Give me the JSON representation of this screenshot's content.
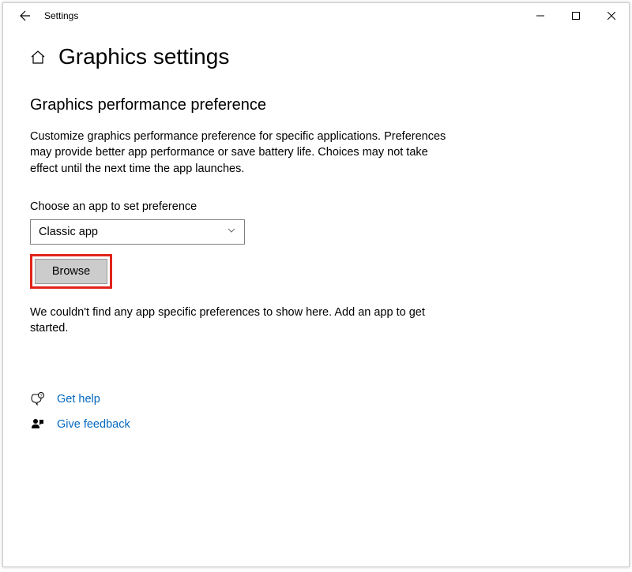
{
  "window": {
    "title": "Settings"
  },
  "page": {
    "title": "Graphics settings"
  },
  "section": {
    "heading": "Graphics performance preference",
    "description": "Customize graphics performance preference for specific applications. Preferences may provide better app performance or save battery life. Choices may not take effect until the next time the app launches."
  },
  "dropdown": {
    "label": "Choose an app to set preference",
    "value": "Classic app"
  },
  "browse": {
    "label": "Browse"
  },
  "empty": {
    "message": "We couldn't find any app specific preferences to show here. Add an app to get started."
  },
  "links": {
    "help": "Get help",
    "feedback": "Give feedback"
  }
}
